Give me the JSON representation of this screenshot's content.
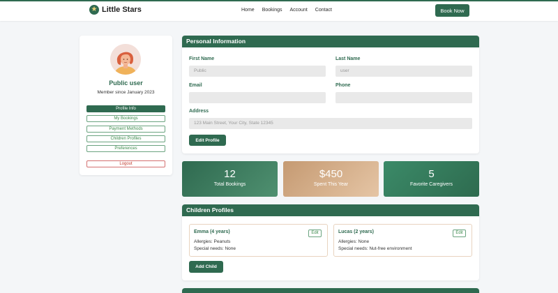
{
  "nav": {
    "brand": "Little Stars",
    "links": [
      "Home",
      "Bookings",
      "Account",
      "Contact"
    ],
    "cta": "Book Now"
  },
  "profile": {
    "name": "Public user",
    "member_since": "Member since January 2023",
    "menu": [
      "Profile Info",
      "My Bookings",
      "Payment Methods",
      "Children Profiles",
      "Preferences"
    ],
    "logout": "Logout"
  },
  "personal": {
    "title": "Personal Information",
    "first_name_label": "First Name",
    "first_name_value": "Public",
    "last_name_label": "Last Name",
    "last_name_value": "user",
    "email_label": "Email",
    "email_value": "",
    "phone_label": "Phone",
    "phone_value": "",
    "address_label": "Address",
    "address_value": "123 Main Street, Your City, State 12345",
    "edit_button": "Edit Profile"
  },
  "stats": [
    {
      "value": "12",
      "label": "Total Bookings"
    },
    {
      "value": "$450",
      "label": "Spent This Year"
    },
    {
      "value": "5",
      "label": "Favorite Caregivers"
    }
  ],
  "children": {
    "title": "Children Profiles",
    "items": [
      {
        "name": "Emma (4 years)",
        "allergies": "Allergies: Peanuts",
        "needs": "Special needs: None",
        "edit": "Edit"
      },
      {
        "name": "Lucas (2 years)",
        "allergies": "Allergies: None",
        "needs": "Special needs: Nut-free environment",
        "edit": "Edit"
      }
    ],
    "add_button": "Add Child"
  },
  "colors": {
    "primary": "#2f6a50",
    "accent_tan": "#d8b58e",
    "danger": "#c0392b"
  },
  "icons": {
    "brand": "star-icon",
    "avatar": "user-avatar-illustration"
  }
}
